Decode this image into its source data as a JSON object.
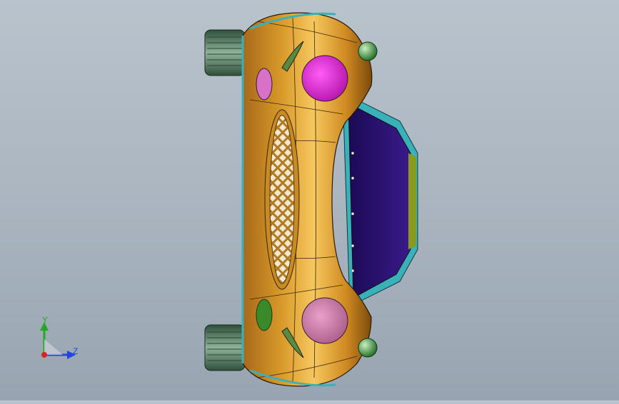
{
  "viewport": {
    "background_top": "#b9c3cc",
    "background_bottom": "#98a4b1"
  },
  "model": {
    "body_color": "#d89a2a",
    "body_highlight": "#f3c35a",
    "body_shadow": "#8a5a10",
    "glass_color": "#2a0f6e",
    "headlight_left_color": "#e01ad8",
    "headlight_right_color": "#c87aa8",
    "foglight_color": "#d872c8",
    "indicator_color": "#3a8a2a",
    "tire_color": "#5c8a6a",
    "trim_color": "#3ab0b8"
  },
  "triad": {
    "y_label": "Y",
    "z_label": "Z",
    "y_color": "#22aa22",
    "z_color": "#2244dd",
    "x_color": "#dd2222"
  }
}
